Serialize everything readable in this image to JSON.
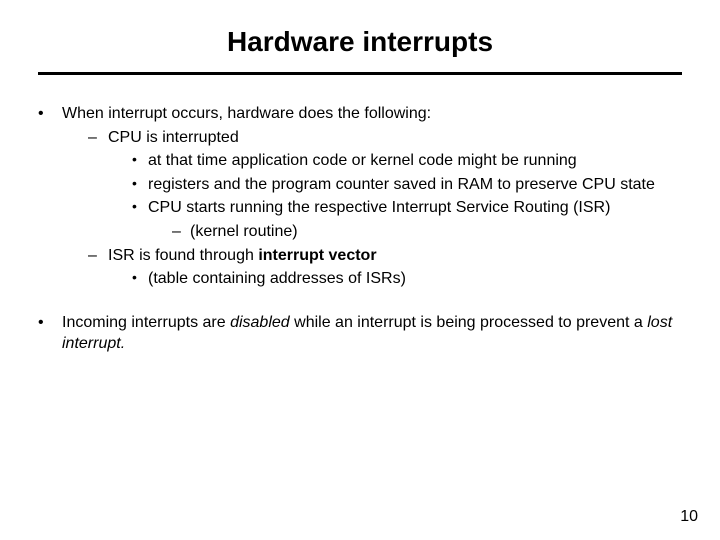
{
  "title": "Hardware interrupts",
  "b1": {
    "lead": "When interrupt occurs, hardware does the following:",
    "d1": "CPU is interrupted",
    "d1_s1": "at that time application code or kernel code might be running",
    "d1_s2": "registers and the program counter saved in RAM to preserve CPU state",
    "d1_s3": "CPU starts running the respective Interrupt Service Routing (ISR)",
    "d1_s3_a": "(kernel routine)",
    "d2_pre": "ISR is found through ",
    "d2_bold": "interrupt vector",
    "d2_s1": "(table containing addresses of ISRs)"
  },
  "b2": {
    "pre": "Incoming interrupts are ",
    "em1": "disabled",
    "mid": " while an interrupt is being processed to prevent a ",
    "em2": "lost interrupt.",
    "post": ""
  },
  "page": "10"
}
